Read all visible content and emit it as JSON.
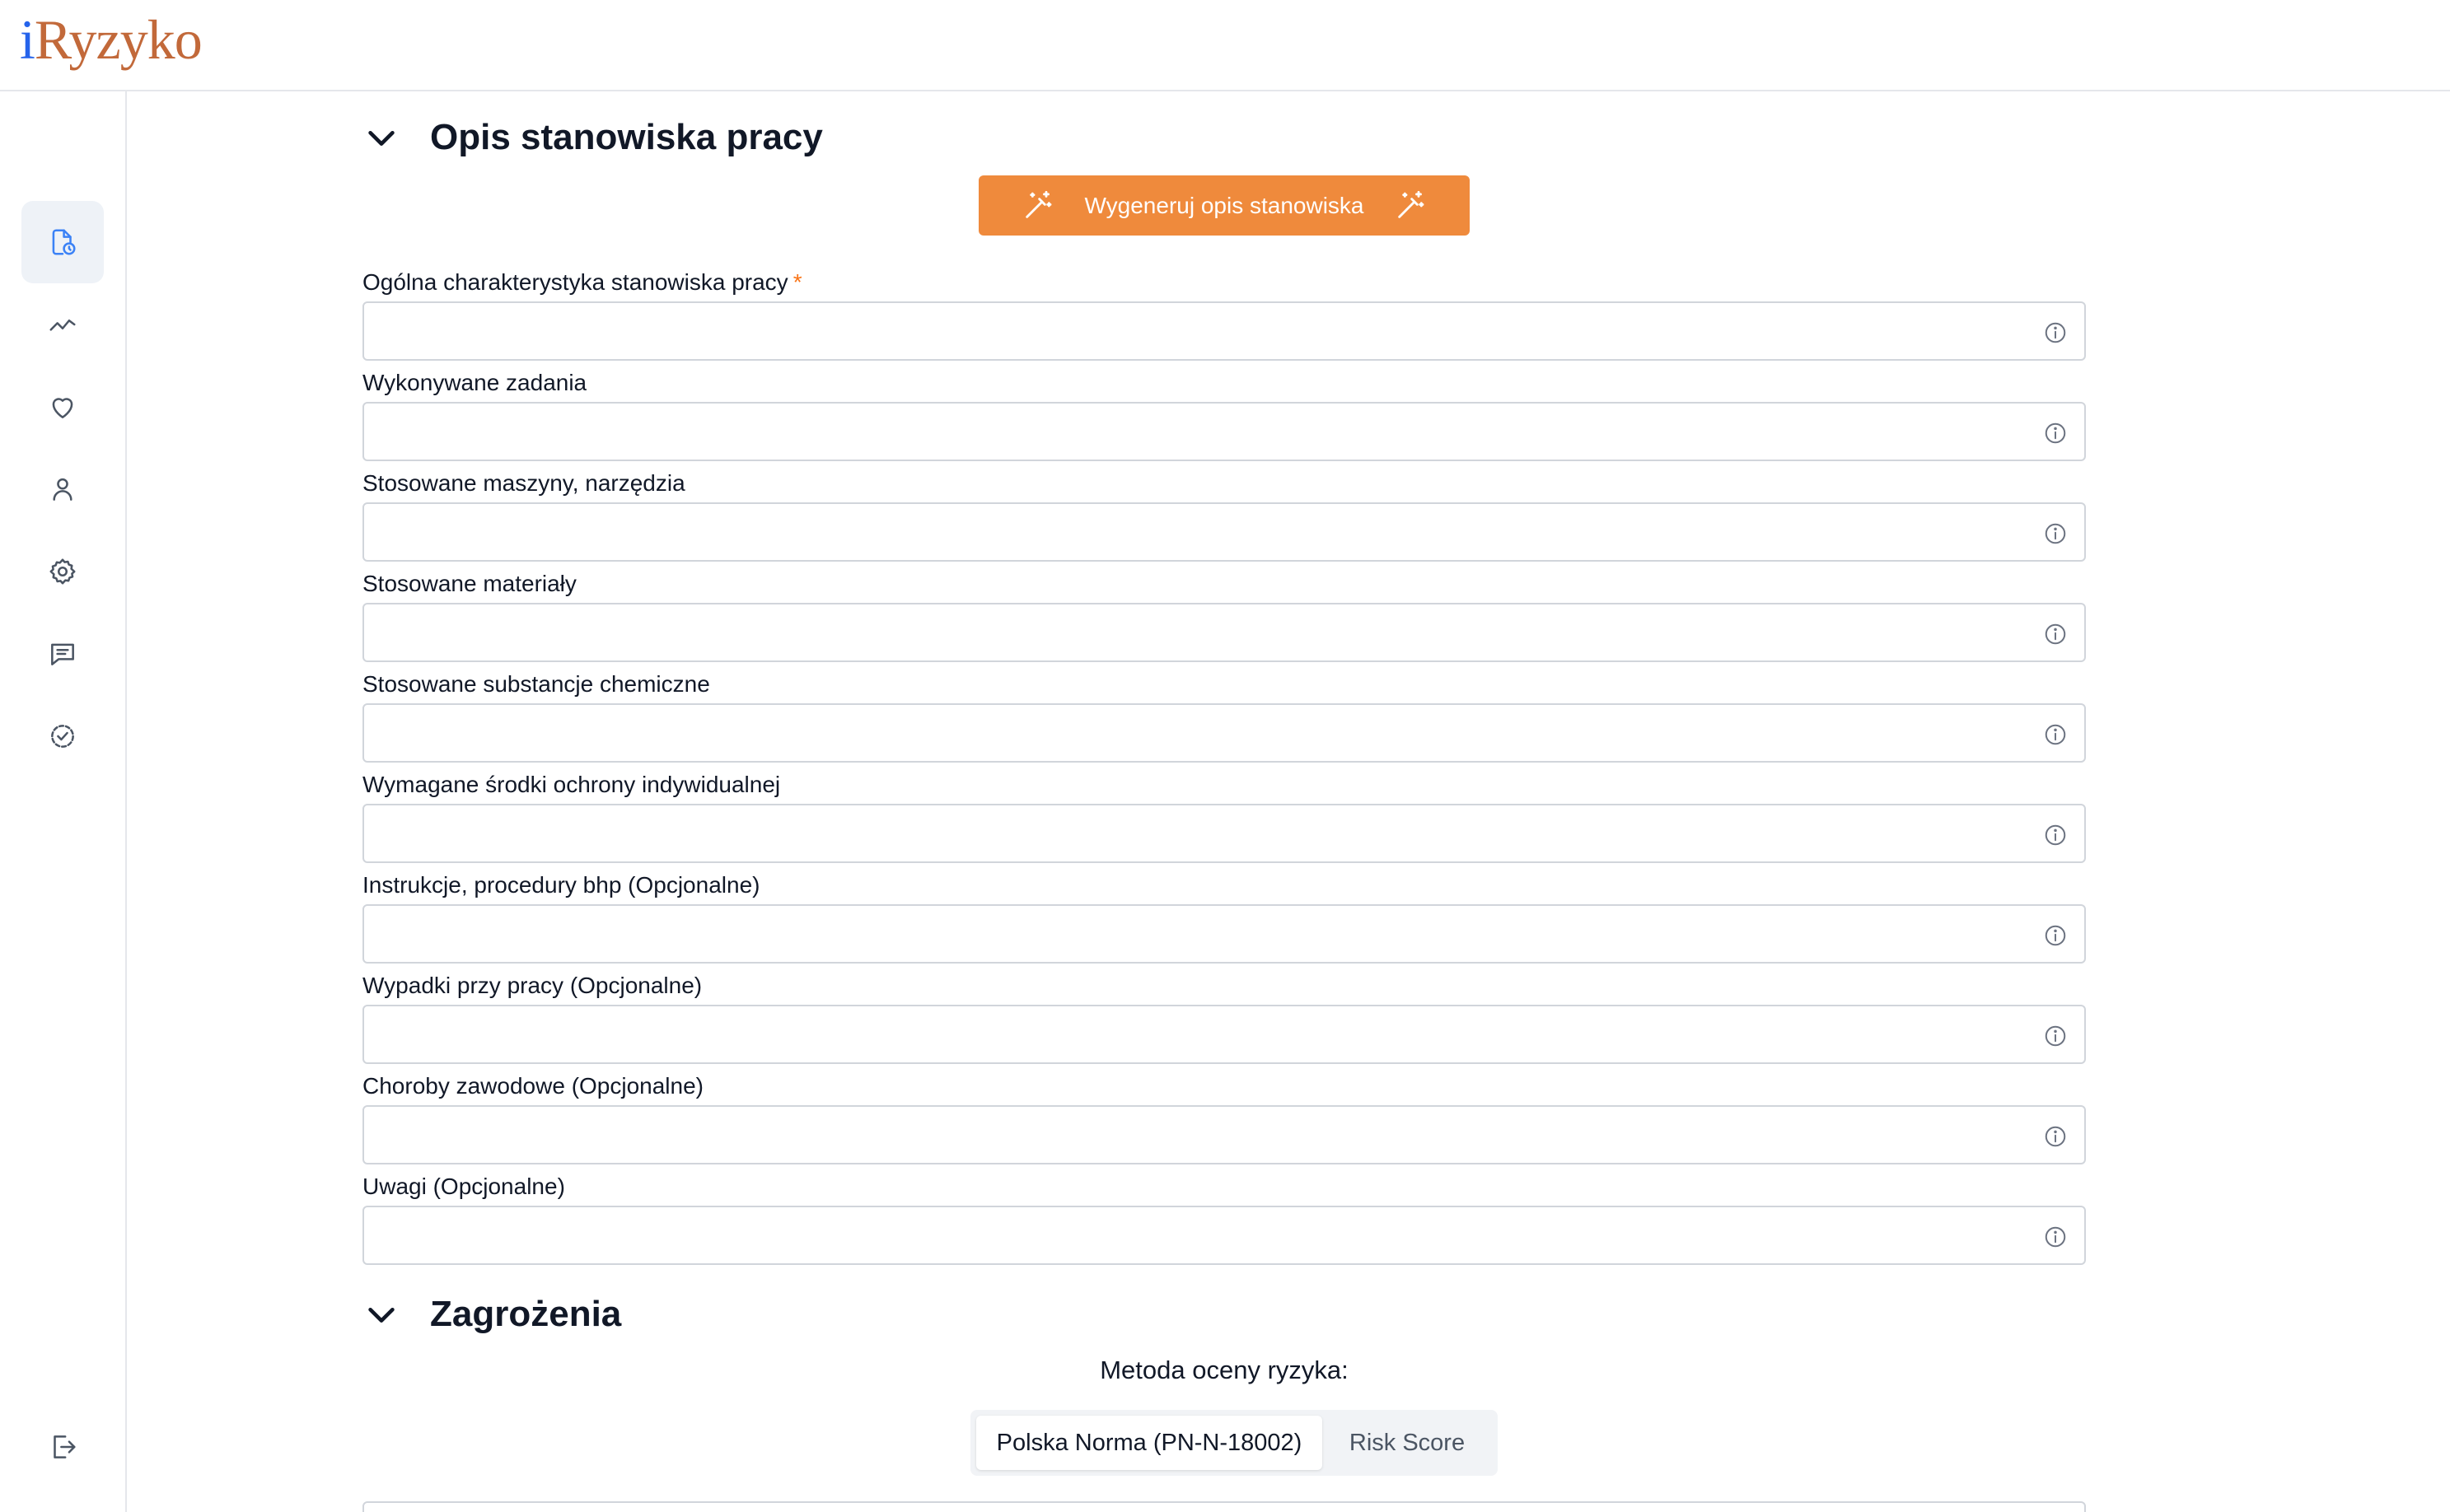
{
  "app": {
    "logo_prefix": "i",
    "logo_rest": "Ryzyko"
  },
  "sidebar": {
    "items": [
      {
        "icon": "document-clock-icon",
        "active": true
      },
      {
        "icon": "trend-line-icon",
        "active": false
      },
      {
        "icon": "heart-icon",
        "active": false
      },
      {
        "icon": "user-icon",
        "active": false
      },
      {
        "icon": "gear-icon",
        "active": false
      },
      {
        "icon": "message-icon",
        "active": false
      },
      {
        "icon": "circle-check-icon",
        "active": false
      },
      {
        "icon": "logout-icon",
        "active": false
      }
    ]
  },
  "description_section": {
    "title": "Opis stanowiska pracy",
    "generate_button": "Wygeneruj opis stanowiska",
    "fields": [
      {
        "label": "Ogólna charakterystyka stanowiska pracy",
        "required_mark": "*",
        "value": ""
      },
      {
        "label": "Wykonywane zadania",
        "value": ""
      },
      {
        "label": "Stosowane maszyny, narzędzia",
        "value": ""
      },
      {
        "label": "Stosowane materiały",
        "value": ""
      },
      {
        "label": "Stosowane substancje chemiczne",
        "value": ""
      },
      {
        "label": "Wymagane środki ochrony indywidualnej",
        "value": ""
      },
      {
        "label": "Instrukcje, procedury bhp (Opcjonalne)",
        "value": ""
      },
      {
        "label": "Wypadki przy pracy (Opcjonalne)",
        "value": ""
      },
      {
        "label": "Choroby zawodowe (Opcjonalne)",
        "value": ""
      },
      {
        "label": "Uwagi (Opcjonalne)",
        "value": ""
      }
    ]
  },
  "hazards_section": {
    "title": "Zagrożenia",
    "method_label": "Metoda oceny ryzyka:",
    "methods": [
      {
        "label": "Polska Norma (PN-N-18002)",
        "selected": true
      },
      {
        "label": "Risk Score",
        "selected": false
      }
    ]
  },
  "colors": {
    "accent_orange": "#ef8a3c",
    "logo_orange": "#c2693a",
    "logo_blue": "#2563eb",
    "required_mark": "#f97316"
  }
}
